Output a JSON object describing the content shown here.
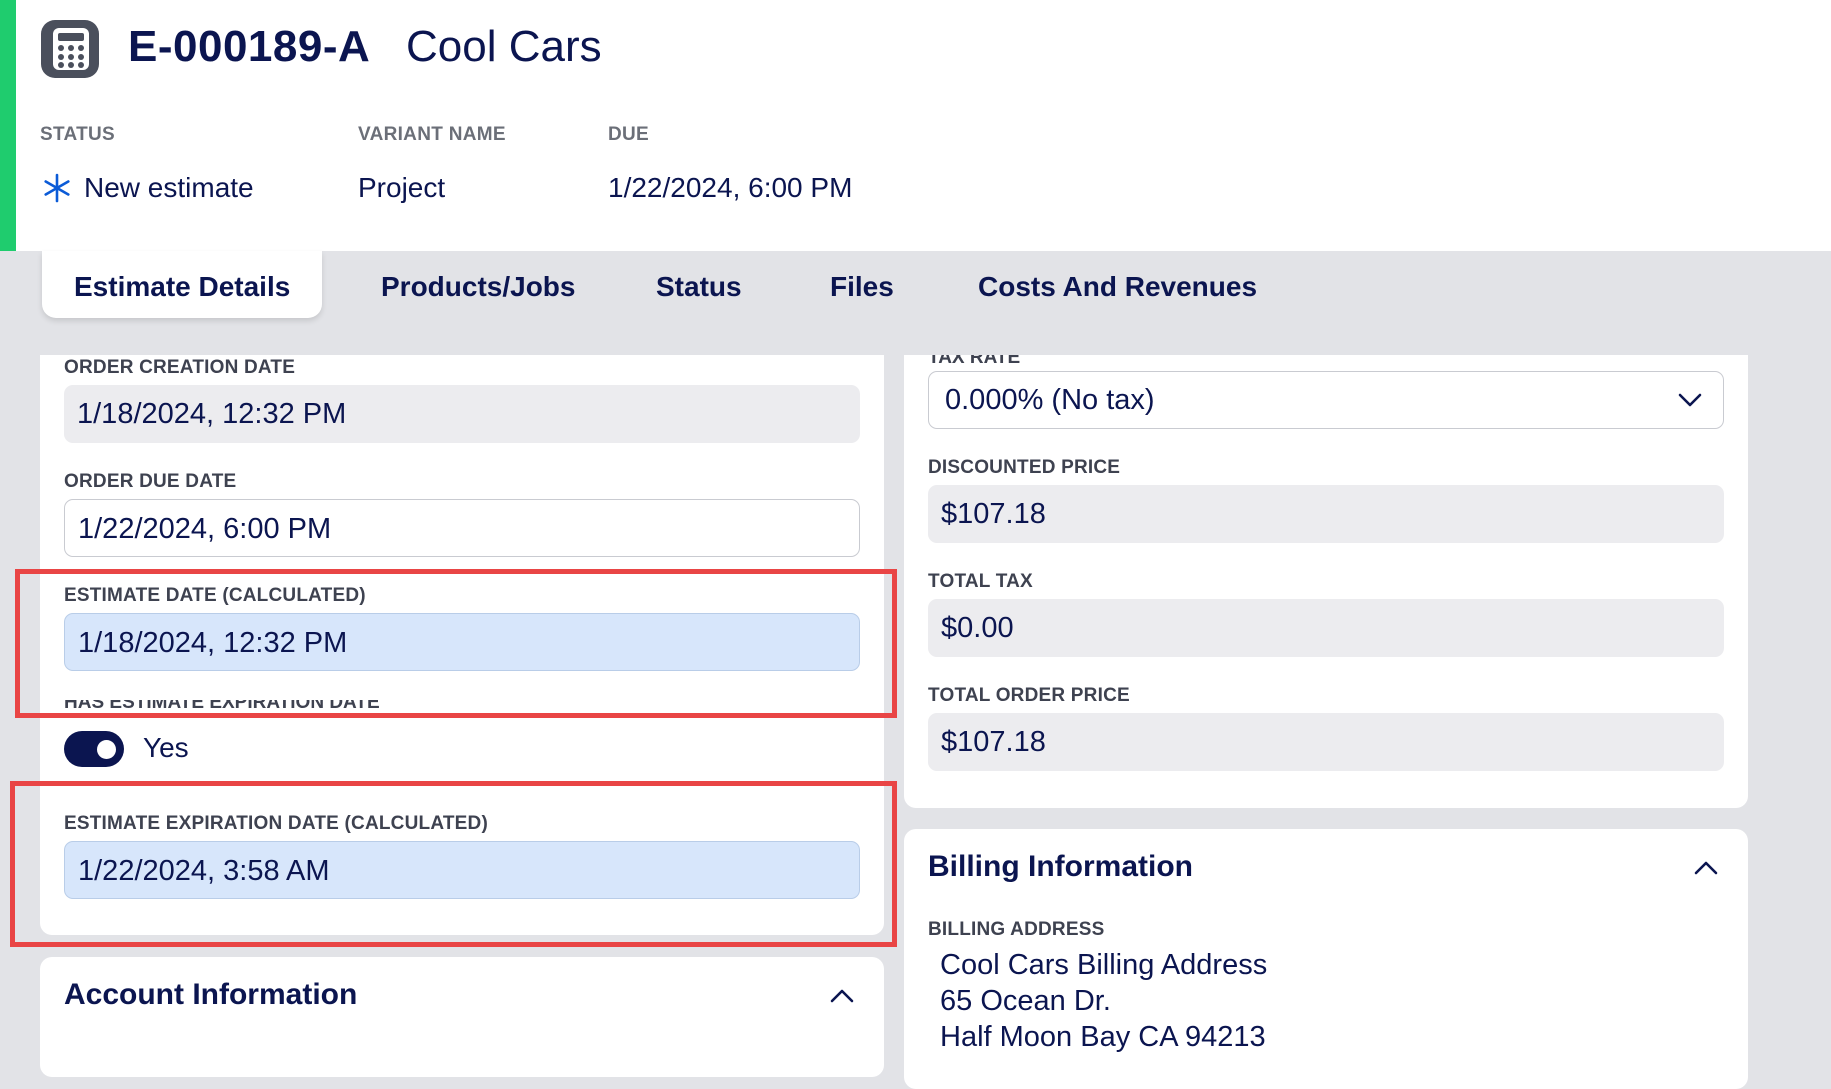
{
  "header": {
    "record_id": "E-000189-A",
    "record_name": "Cool Cars",
    "meta": [
      {
        "label": "STATUS",
        "value": "New estimate",
        "icon": "asterisk-icon"
      },
      {
        "label": "VARIANT NAME",
        "value": "Project"
      },
      {
        "label": "DUE",
        "value": "1/22/2024, 6:00 PM"
      }
    ],
    "accent_color": "#1fcc6e"
  },
  "tabs": [
    {
      "label": "Estimate Details",
      "active": true
    },
    {
      "label": "Products/Jobs"
    },
    {
      "label": "Status"
    },
    {
      "label": "Files"
    },
    {
      "label": "Costs And Revenues"
    }
  ],
  "left_panel": {
    "order_creation_date": {
      "label": "ORDER CREATION DATE",
      "value": "1/18/2024, 12:32 PM"
    },
    "order_due_date": {
      "label": "ORDER DUE DATE",
      "value": "1/22/2024, 6:00 PM"
    },
    "estimate_date": {
      "label": "ESTIMATE DATE (CALCULATED)",
      "value": "1/18/2024, 12:32 PM"
    },
    "has_expiration": {
      "label": "HAS ESTIMATE EXPIRATION DATE",
      "value": "Yes"
    },
    "expiration_date": {
      "label": "ESTIMATE EXPIRATION DATE (CALCULATED)",
      "value": "1/22/2024, 3:58 AM"
    },
    "account_section_title": "Account Information"
  },
  "right_panel": {
    "tax_rate": {
      "label": "TAX RATE",
      "value": "0.000% (No tax)"
    },
    "discounted_price": {
      "label": "DISCOUNTED PRICE",
      "value": "$107.18"
    },
    "total_tax": {
      "label": "TOTAL TAX",
      "value": "$0.00"
    },
    "total_order_price": {
      "label": "TOTAL ORDER PRICE",
      "value": "$107.18"
    },
    "billing": {
      "title": "Billing Information",
      "address_label": "BILLING ADDRESS",
      "address_lines": [
        "Cool Cars Billing Address",
        "65 Ocean Dr.",
        "Half Moon Bay CA 94213"
      ]
    }
  },
  "colors": {
    "navy": "#0b1550",
    "highlight_red": "#e94545",
    "calculated_field_bg": "#d7e6fb",
    "readonly_field_bg": "#ececef"
  }
}
